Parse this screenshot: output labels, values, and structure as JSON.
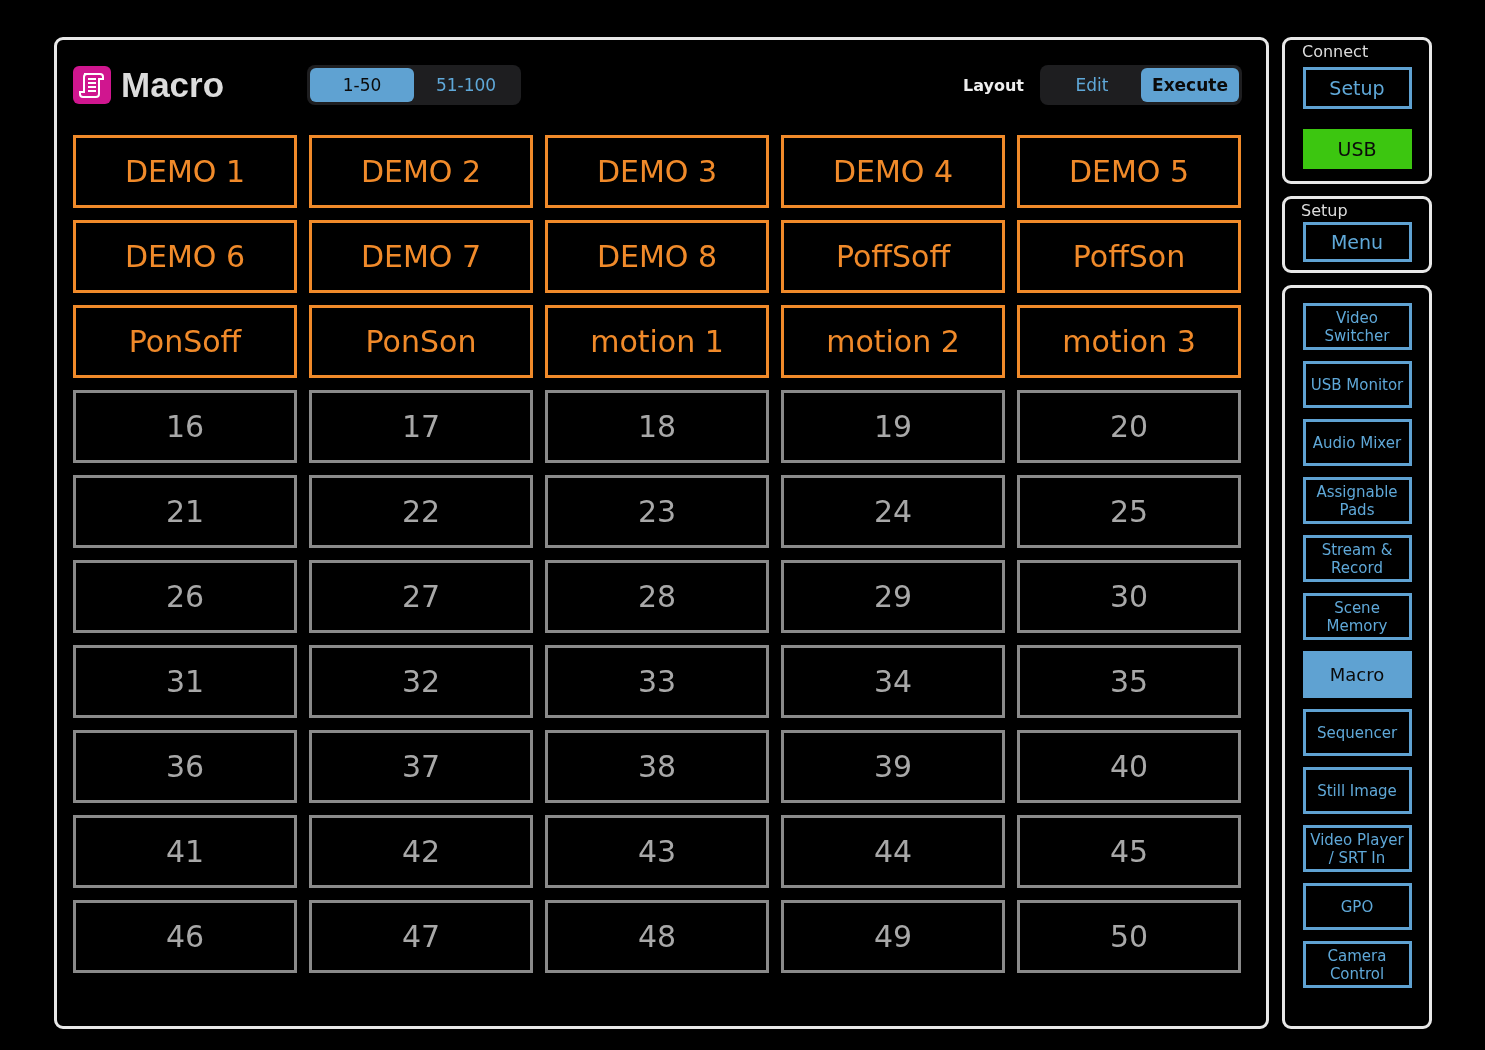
{
  "header": {
    "title": "Macro",
    "pages": [
      {
        "label": "1-50",
        "selected": true
      },
      {
        "label": "51-100",
        "selected": false
      }
    ],
    "layout_label": "Layout",
    "layout_modes": [
      {
        "label": "Edit",
        "selected": false
      },
      {
        "label": "Execute",
        "selected": true
      }
    ]
  },
  "macros": [
    {
      "label": "DEMO 1",
      "assigned": true
    },
    {
      "label": "DEMO 2",
      "assigned": true
    },
    {
      "label": "DEMO 3",
      "assigned": true
    },
    {
      "label": "DEMO 4",
      "assigned": true
    },
    {
      "label": "DEMO 5",
      "assigned": true
    },
    {
      "label": "DEMO 6",
      "assigned": true
    },
    {
      "label": "DEMO 7",
      "assigned": true
    },
    {
      "label": "DEMO 8",
      "assigned": true
    },
    {
      "label": "PoffSoff",
      "assigned": true
    },
    {
      "label": "PoffSon",
      "assigned": true
    },
    {
      "label": "PonSoff",
      "assigned": true
    },
    {
      "label": "PonSon",
      "assigned": true
    },
    {
      "label": "motion 1",
      "assigned": true
    },
    {
      "label": "motion 2",
      "assigned": true
    },
    {
      "label": "motion 3",
      "assigned": true
    },
    {
      "label": "16",
      "assigned": false
    },
    {
      "label": "17",
      "assigned": false
    },
    {
      "label": "18",
      "assigned": false
    },
    {
      "label": "19",
      "assigned": false
    },
    {
      "label": "20",
      "assigned": false
    },
    {
      "label": "21",
      "assigned": false
    },
    {
      "label": "22",
      "assigned": false
    },
    {
      "label": "23",
      "assigned": false
    },
    {
      "label": "24",
      "assigned": false
    },
    {
      "label": "25",
      "assigned": false
    },
    {
      "label": "26",
      "assigned": false
    },
    {
      "label": "27",
      "assigned": false
    },
    {
      "label": "28",
      "assigned": false
    },
    {
      "label": "29",
      "assigned": false
    },
    {
      "label": "30",
      "assigned": false
    },
    {
      "label": "31",
      "assigned": false
    },
    {
      "label": "32",
      "assigned": false
    },
    {
      "label": "33",
      "assigned": false
    },
    {
      "label": "34",
      "assigned": false
    },
    {
      "label": "35",
      "assigned": false
    },
    {
      "label": "36",
      "assigned": false
    },
    {
      "label": "37",
      "assigned": false
    },
    {
      "label": "38",
      "assigned": false
    },
    {
      "label": "39",
      "assigned": false
    },
    {
      "label": "40",
      "assigned": false
    },
    {
      "label": "41",
      "assigned": false
    },
    {
      "label": "42",
      "assigned": false
    },
    {
      "label": "43",
      "assigned": false
    },
    {
      "label": "44",
      "assigned": false
    },
    {
      "label": "45",
      "assigned": false
    },
    {
      "label": "46",
      "assigned": false
    },
    {
      "label": "47",
      "assigned": false
    },
    {
      "label": "48",
      "assigned": false
    },
    {
      "label": "49",
      "assigned": false
    },
    {
      "label": "50",
      "assigned": false
    }
  ],
  "connect": {
    "title": "Connect",
    "setup_button": "Setup",
    "usb_button": {
      "label": "USB",
      "on": true
    }
  },
  "setup": {
    "title": "Setup",
    "menu_button": "Menu"
  },
  "nav": [
    {
      "label": "Video Switcher",
      "selected": false
    },
    {
      "label": "USB Monitor",
      "selected": false
    },
    {
      "label": "Audio Mixer",
      "selected": false
    },
    {
      "label": "Assignable Pads",
      "selected": false
    },
    {
      "label": "Stream & Record",
      "selected": false
    },
    {
      "label": "Scene Memory",
      "selected": false
    },
    {
      "label": "Macro",
      "selected": true
    },
    {
      "label": "Sequencer",
      "selected": false
    },
    {
      "label": "Still Image",
      "selected": false
    },
    {
      "label": "Video Player / SRT In",
      "selected": false
    },
    {
      "label": "GPO",
      "selected": false
    },
    {
      "label": "Camera Control",
      "selected": false
    }
  ]
}
